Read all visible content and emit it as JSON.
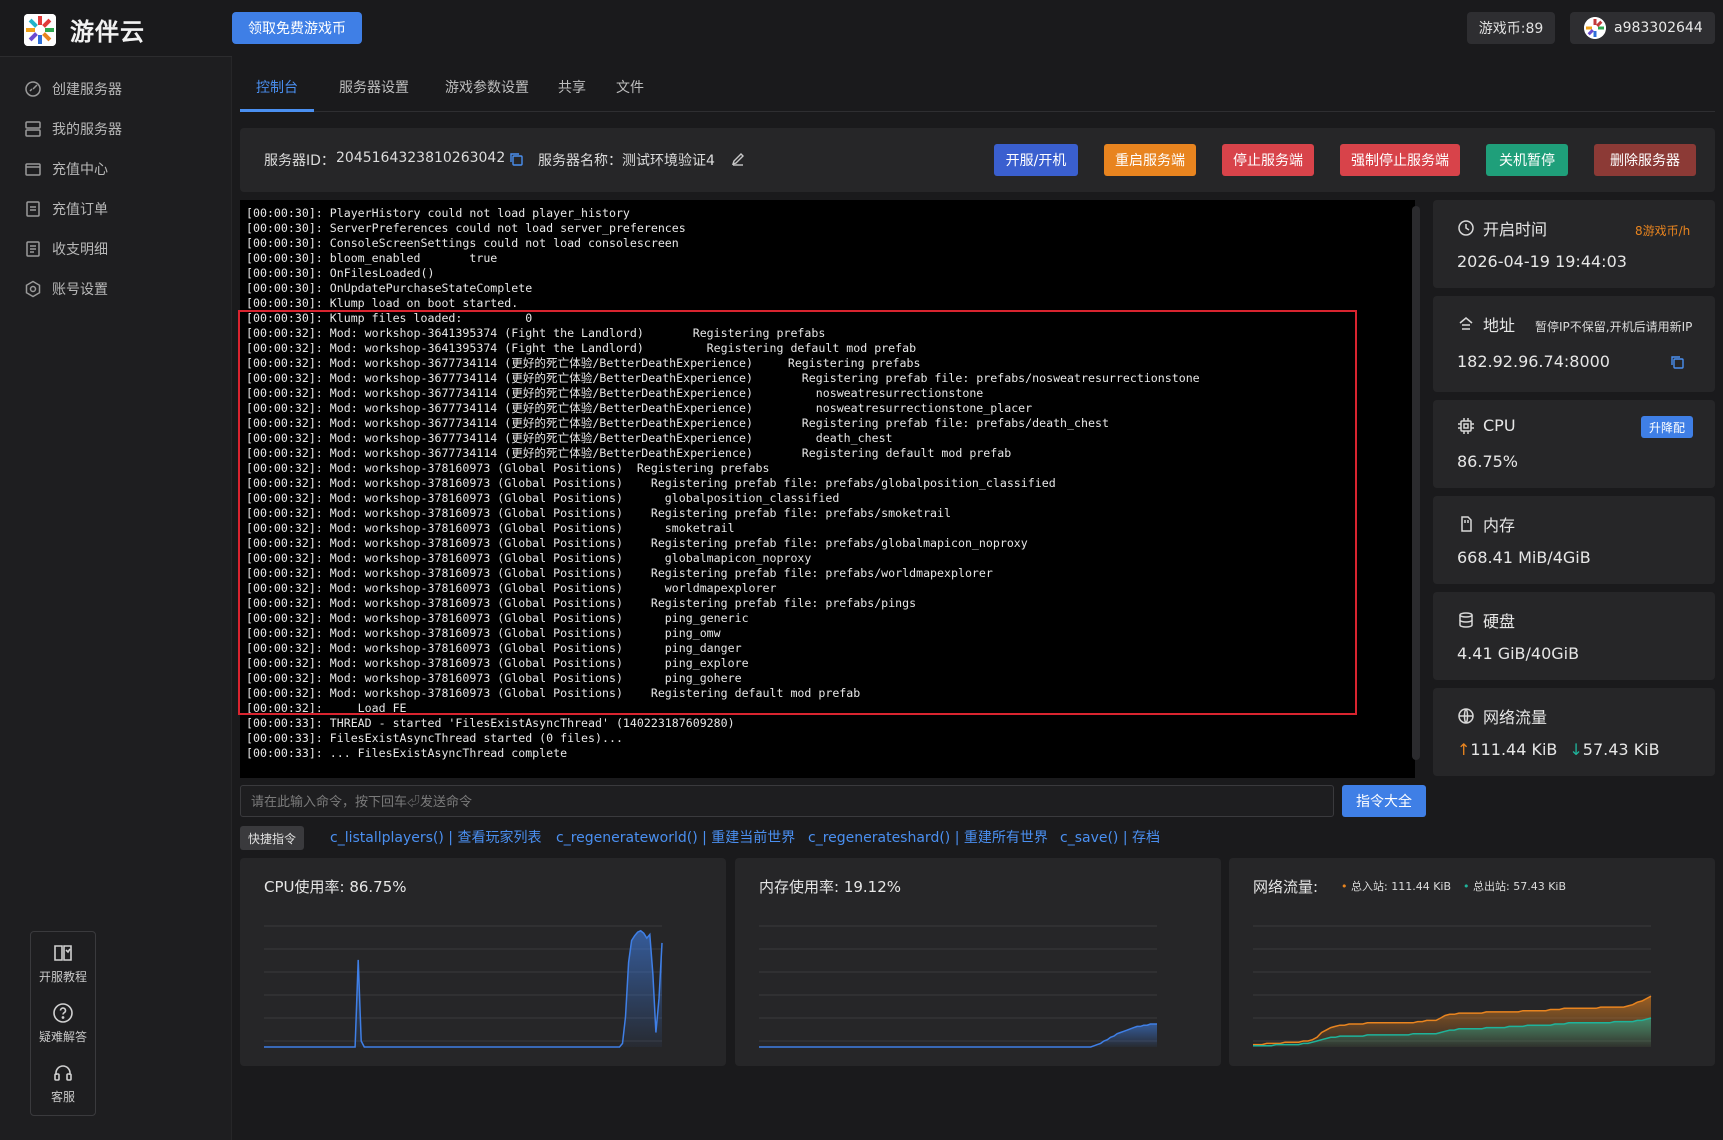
{
  "app": {
    "name": "游伴云",
    "free_coins_button": "领取免费游戏币",
    "coins": "游戏币:89",
    "username": "a983302644"
  },
  "sidebar": {
    "items": [
      {
        "label": "创建服务器",
        "icon": "create-server-icon"
      },
      {
        "label": "我的服务器",
        "icon": "server-list-icon"
      },
      {
        "label": "充值中心",
        "icon": "wallet-icon"
      },
      {
        "label": "充值订单",
        "icon": "order-icon"
      },
      {
        "label": "收支明细",
        "icon": "ledger-icon"
      },
      {
        "label": "账号设置",
        "icon": "settings-icon"
      }
    ],
    "help": [
      {
        "label": "开服教程",
        "icon": "book-icon"
      },
      {
        "label": "疑难解答",
        "icon": "question-icon"
      },
      {
        "label": "客服",
        "icon": "headset-icon"
      }
    ]
  },
  "tabs": [
    "控制台",
    "服务器设置",
    "游戏参数设置",
    "共享",
    "文件"
  ],
  "server": {
    "id_label": "服务器ID：",
    "id": "2045164323810263042",
    "name_label": "服务器名称：",
    "name": "测试环境验证4"
  },
  "actions": [
    {
      "label": "开服/开机",
      "color": "#3a5fcf"
    },
    {
      "label": "重启服务端",
      "color": "#e8841f"
    },
    {
      "label": "停止服务端",
      "color": "#d8434a"
    },
    {
      "label": "强制停止服务端",
      "color": "#d8434a"
    },
    {
      "label": "关机暂停",
      "color": "#1f9f7a"
    },
    {
      "label": "删除服务器",
      "color": "#8c3a36"
    }
  ],
  "console": {
    "lines": [
      "[00:00:30]: PlayerHistory could not load player_history",
      "[00:00:30]: ServerPreferences could not load server_preferences",
      "[00:00:30]: ConsoleScreenSettings could not load consolescreen",
      "[00:00:30]: bloom_enabled       true",
      "[00:00:30]: OnFilesLoaded()",
      "[00:00:30]: OnUpdatePurchaseStateComplete",
      "[00:00:30]: Klump load on boot started.",
      "[00:00:30]: Klump files loaded:         0",
      "[00:00:32]: Mod: workshop-3641395374 (Fight the Landlord)       Registering prefabs",
      "[00:00:32]: Mod: workshop-3641395374 (Fight the Landlord)         Registering default mod prefab",
      "[00:00:32]: Mod: workshop-3677734114 (更好的死亡体验/BetterDeathExperience)     Registering prefabs",
      "[00:00:32]: Mod: workshop-3677734114 (更好的死亡体验/BetterDeathExperience)       Registering prefab file: prefabs/nosweatresurrectionstone",
      "[00:00:32]: Mod: workshop-3677734114 (更好的死亡体验/BetterDeathExperience)         nosweatresurrectionstone",
      "[00:00:32]: Mod: workshop-3677734114 (更好的死亡体验/BetterDeathExperience)         nosweatresurrectionstone_placer",
      "[00:00:32]: Mod: workshop-3677734114 (更好的死亡体验/BetterDeathExperience)       Registering prefab file: prefabs/death_chest",
      "[00:00:32]: Mod: workshop-3677734114 (更好的死亡体验/BetterDeathExperience)         death_chest",
      "[00:00:32]: Mod: workshop-3677734114 (更好的死亡体验/BetterDeathExperience)       Registering default mod prefab",
      "[00:00:32]: Mod: workshop-378160973 (Global Positions)  Registering prefabs",
      "[00:00:32]: Mod: workshop-378160973 (Global Positions)    Registering prefab file: prefabs/globalposition_classified",
      "[00:00:32]: Mod: workshop-378160973 (Global Positions)      globalposition_classified",
      "[00:00:32]: Mod: workshop-378160973 (Global Positions)    Registering prefab file: prefabs/smoketrail",
      "[00:00:32]: Mod: workshop-378160973 (Global Positions)      smoketrail",
      "[00:00:32]: Mod: workshop-378160973 (Global Positions)    Registering prefab file: prefabs/globalmapicon_noproxy",
      "[00:00:32]: Mod: workshop-378160973 (Global Positions)      globalmapicon_noproxy",
      "[00:00:32]: Mod: workshop-378160973 (Global Positions)    Registering prefab file: prefabs/worldmapexplorer",
      "[00:00:32]: Mod: workshop-378160973 (Global Positions)      worldmapexplorer",
      "[00:00:32]: Mod: workshop-378160973 (Global Positions)    Registering prefab file: prefabs/pings",
      "[00:00:32]: Mod: workshop-378160973 (Global Positions)      ping_generic",
      "[00:00:32]: Mod: workshop-378160973 (Global Positions)      ping_omw",
      "[00:00:32]: Mod: workshop-378160973 (Global Positions)      ping_danger",
      "[00:00:32]: Mod: workshop-378160973 (Global Positions)      ping_explore",
      "[00:00:32]: Mod: workshop-378160973 (Global Positions)      ping_gohere",
      "[00:00:32]: Mod: workshop-378160973 (Global Positions)    Registering default mod prefab",
      "[00:00:32]:     Load FE",
      "[00:00:33]: THREAD - started 'FilesExistAsyncThread' (140223187609280)",
      "[00:00:33]: FilesExistAsyncThread started (0 files)...",
      "[00:00:33]: ... FilesExistAsyncThread complete"
    ]
  },
  "command": {
    "placeholder": "请在此输入命令，按下回车⏎发送命令",
    "button": "指令大全",
    "quick_label": "快捷指令",
    "quick": [
      "c_listallplayers() | 查看玩家列表",
      "c_regenerateworld() | 重建当前世界",
      "c_regenerateshard() | 重建所有世界",
      "c_save() | 存档"
    ]
  },
  "stats": {
    "start_time": {
      "label": "开启时间",
      "rate": "8游戏币/h",
      "value": "2026-04-19 19:44:03"
    },
    "address": {
      "label": "地址",
      "note": "暂停IP不保留,开机后请用新IP",
      "value": "182.92.96.74:8000"
    },
    "cpu": {
      "label": "CPU",
      "badge": "升降配",
      "value": "86.75%"
    },
    "memory": {
      "label": "内存",
      "value": "668.41 MiB/4GiB"
    },
    "disk": {
      "label": "硬盘",
      "value": "4.41 GiB/40GiB"
    },
    "network": {
      "label": "网络流量",
      "up": "111.44 KiB",
      "down": "57.43 KiB",
      "up_color": "#e8841f",
      "down_color": "#1fb39a"
    }
  },
  "charts": {
    "cpu_title": "CPU使用率: 86.75%",
    "mem_title": "内存使用率: 19.12%",
    "net_title": "网络流量:",
    "net_in_label": "总入站: 111.44 KiB",
    "net_out_label": "总出站: 57.43 KiB"
  },
  "chart_data": [
    {
      "type": "area",
      "title": "CPU使用率: 86.75%",
      "series": [
        {
          "values": [
            0,
            0,
            0,
            0,
            0,
            0,
            0,
            0,
            0,
            0,
            0,
            0,
            0,
            0,
            0,
            0,
            0,
            0,
            0,
            0,
            0,
            0,
            0,
            0,
            0,
            0,
            0,
            0,
            0,
            0,
            0,
            72,
            5,
            0,
            0,
            0,
            0,
            0,
            0,
            0,
            0,
            0,
            0,
            0,
            0,
            0,
            0,
            0,
            0,
            0,
            0,
            0,
            0,
            0,
            0,
            0,
            0,
            0,
            0,
            0,
            0,
            0,
            0,
            0,
            0,
            0,
            0,
            0,
            0,
            0,
            0,
            0,
            0,
            0,
            0,
            0,
            0,
            0,
            0,
            0,
            0,
            0,
            0,
            0,
            0,
            0,
            0,
            0,
            0,
            0,
            0,
            0,
            0,
            0,
            0,
            0,
            0,
            0,
            0,
            0,
            0,
            0,
            0,
            0,
            0,
            0,
            0,
            0,
            0,
            0,
            0,
            0,
            0,
            0,
            0,
            0,
            0,
            0,
            3,
            25,
            70,
            88,
            92,
            95,
            96,
            94,
            90,
            93,
            60,
            12,
            40,
            86
          ]
        }
      ]
    },
    {
      "type": "area",
      "title": "内存使用率: 19.12%",
      "series": [
        {
          "values": [
            0,
            0,
            0,
            0,
            0,
            0,
            0,
            0,
            0,
            0,
            0,
            0,
            0,
            0,
            0,
            0,
            0,
            0,
            0,
            0,
            0,
            0,
            0,
            0,
            0,
            0,
            0,
            0,
            0,
            0,
            0,
            0,
            0,
            0,
            0,
            0,
            0,
            0,
            0,
            0,
            0,
            0,
            0,
            0,
            0,
            0,
            0,
            0,
            0,
            0,
            0,
            0,
            0,
            0,
            0,
            0,
            0,
            0,
            0,
            0,
            0,
            0,
            0,
            0,
            0,
            0,
            0,
            0,
            0,
            0,
            0,
            0,
            0,
            0,
            0,
            0,
            0,
            0,
            0,
            0,
            0,
            0,
            0,
            0,
            0,
            0,
            0,
            0,
            0,
            0,
            0,
            0,
            0,
            0,
            0,
            0,
            0,
            0,
            0,
            0,
            0,
            1,
            2,
            3,
            5,
            6,
            8,
            9,
            11,
            12,
            13,
            14,
            15,
            16,
            17,
            17,
            18,
            18,
            19,
            19,
            19
          ]
        }
      ]
    },
    {
      "type": "line",
      "title": "网络流量:",
      "series": [
        {
          "name": "总入站: 111.44 KiB",
          "color": "#e8841f",
          "values": [
            2,
            2,
            2,
            3,
            3,
            3,
            3,
            4,
            4,
            4,
            4,
            5,
            5,
            6,
            8,
            12,
            14,
            16,
            17,
            18,
            18,
            19,
            19,
            19,
            19,
            20,
            20,
            20,
            20,
            20,
            20,
            20,
            20,
            20,
            20,
            20,
            21,
            21,
            22,
            22,
            22,
            24,
            26,
            27,
            27,
            28,
            28,
            28,
            28,
            28,
            28,
            29,
            29,
            29,
            29,
            29,
            29,
            29,
            29,
            30,
            30,
            30,
            30,
            30,
            30,
            31,
            31,
            31,
            32,
            32,
            32,
            32,
            32,
            32,
            32,
            32,
            33,
            33,
            33,
            33,
            33,
            33,
            34,
            35,
            37,
            38,
            40,
            42
          ]
        },
        {
          "name": "总出站: 57.43 KiB",
          "color": "#1fb39a",
          "values": [
            1,
            1,
            1,
            1,
            1,
            2,
            2,
            2,
            2,
            2,
            2,
            3,
            3,
            4,
            5,
            6,
            7,
            8,
            8,
            9,
            9,
            9,
            9,
            9,
            9,
            10,
            10,
            10,
            10,
            10,
            10,
            10,
            10,
            10,
            10,
            11,
            11,
            11,
            11,
            11,
            11,
            12,
            13,
            14,
            14,
            15,
            15,
            15,
            15,
            15,
            15,
            16,
            16,
            16,
            16,
            16,
            17,
            17,
            17,
            17,
            18,
            18,
            18,
            18,
            18,
            18,
            19,
            19,
            19,
            20,
            20,
            20,
            20,
            20,
            20,
            20,
            20,
            20,
            20,
            21,
            21,
            21,
            21,
            21,
            22,
            22,
            23,
            24
          ]
        }
      ]
    }
  ]
}
